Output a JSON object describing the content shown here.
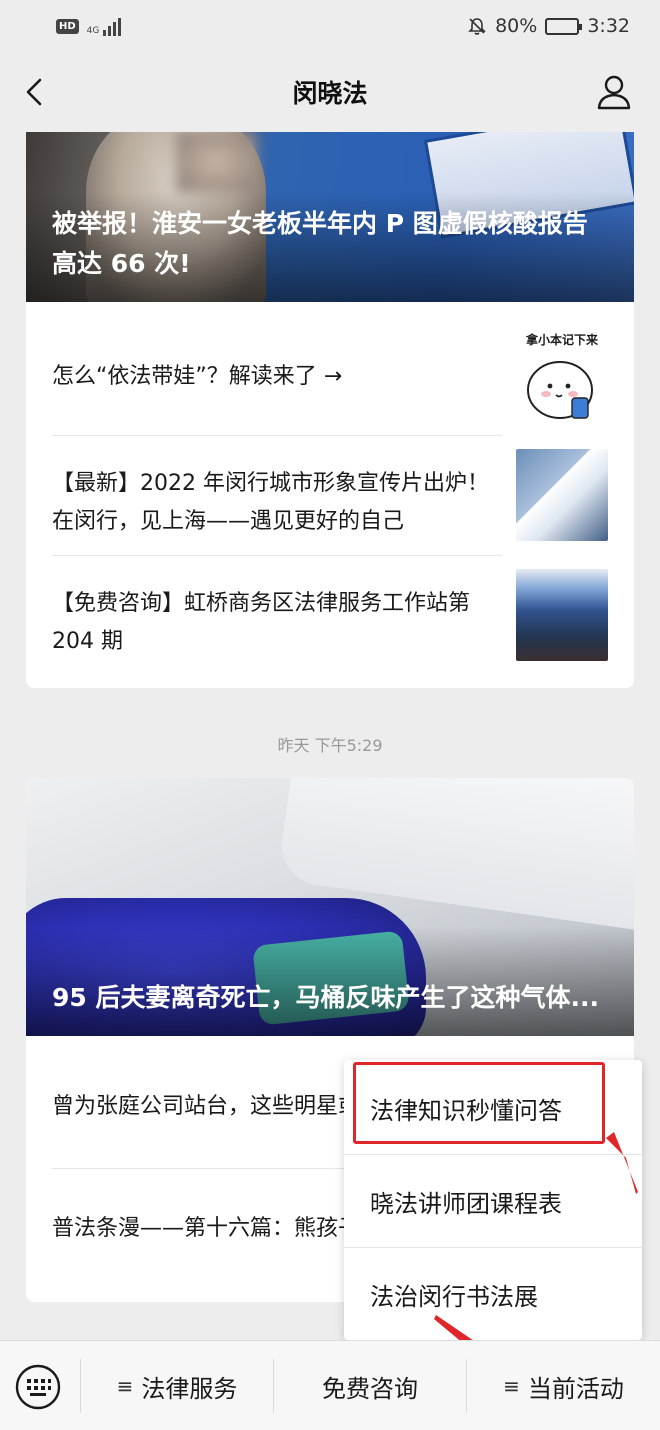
{
  "status_bar": {
    "hd": "HD",
    "network": "4G",
    "battery": "80%",
    "battery_fraction": 0.8,
    "time": "3:32"
  },
  "nav": {
    "title": "闵晓法",
    "back_icon": "back-chevron-icon",
    "profile_icon": "profile-icon"
  },
  "feed": {
    "card1": {
      "hero_title": "被举报！淮安一女老板半年内 P 图虚假核酸报告高达 66 次!",
      "items": [
        {
          "text": "怎么“依法带娃”？解读来了 →",
          "thumb_caption": "拿小本记下来"
        },
        {
          "text": "【最新】2022 年闵行城市形象宣传片出炉！在闵行，见上海——遇见更好的自己"
        },
        {
          "text": "【免费咨询】虹桥商务区法律服务工作站第 204 期"
        }
      ]
    },
    "timestamp": "昨天 下午5:29",
    "card2": {
      "hero_title": "95 后夫妻离奇死亡，马桶反味产生了这种气体...",
      "items": [
        {
          "text": "曾为张庭公司站台，这些明星或被追罚款 →"
        },
        {
          "text": "普法条漫——第十六篇：熊孩子惹祸怎么办？"
        }
      ]
    }
  },
  "popup_menu": {
    "items": [
      "法律知识秒懂问答",
      "晓法讲师团课程表",
      "法治闵行书法展"
    ]
  },
  "bottom_bar": {
    "keyboard_icon": "keyboard-icon",
    "menus": [
      "法律服务",
      "免费咨询",
      "当前活动"
    ],
    "menu_glyph": "≡"
  },
  "colors": {
    "highlight": "#e0262a",
    "background": "#ededed"
  }
}
